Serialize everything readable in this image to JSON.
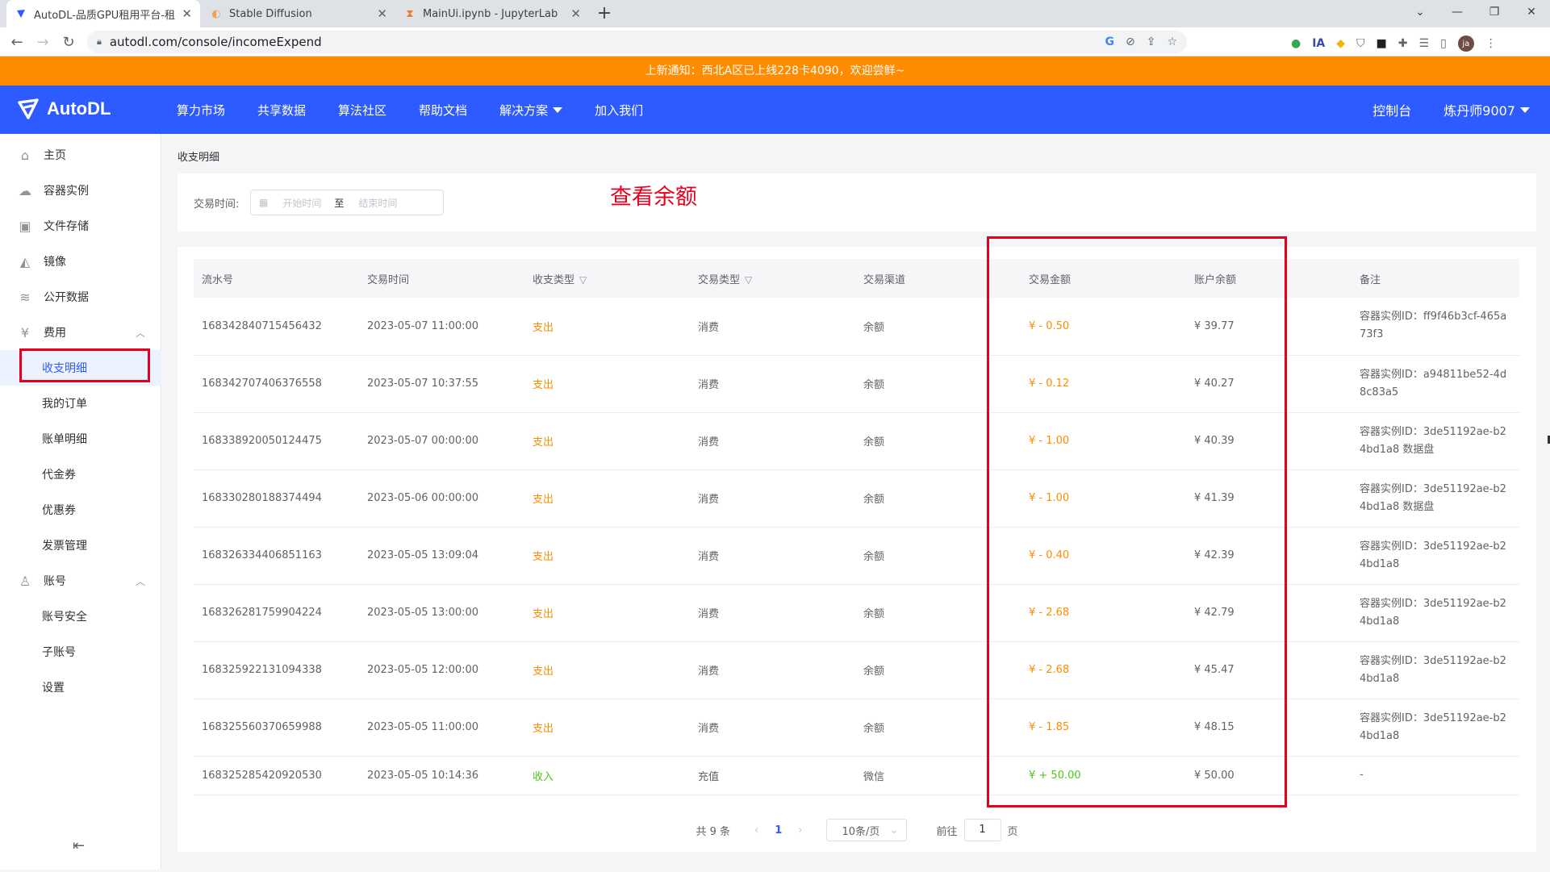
{
  "browser": {
    "tabs": [
      {
        "title": "AutoDL-品质GPU租用平台-租G",
        "active": true
      },
      {
        "title": "Stable Diffusion",
        "active": false
      },
      {
        "title": "MainUi.ipynb - JupyterLab",
        "active": false
      }
    ],
    "url": "autodl.com/console/incomeExpend",
    "profile_initials": "ja"
  },
  "notice": "上新通知：西北A区已上线228卡4090，欢迎尝鲜~",
  "header": {
    "logo": "AutoDL",
    "nav": [
      "算力市场",
      "共享数据",
      "算法社区",
      "帮助文档",
      "解决方案",
      "加入我们"
    ],
    "console": "控制台",
    "user": "炼丹师9007"
  },
  "sidebar": {
    "items": [
      {
        "label": "主页",
        "icon": "home-icon",
        "icon_char": "⌂"
      },
      {
        "label": "容器实例",
        "icon": "container-icon",
        "icon_char": "☁"
      },
      {
        "label": "文件存储",
        "icon": "storage-icon",
        "icon_char": "▣"
      },
      {
        "label": "镜像",
        "icon": "mirror-icon",
        "icon_char": "◭"
      },
      {
        "label": "公开数据",
        "icon": "database-icon",
        "icon_char": "≋"
      },
      {
        "label": "费用",
        "icon": "yen-icon",
        "icon_char": "¥"
      }
    ],
    "fee_sub": [
      "收支明细",
      "我的订单",
      "账单明细",
      "代金券",
      "优惠券",
      "发票管理"
    ],
    "account": {
      "label": "账号",
      "icon": "user-icon",
      "icon_char": "♙"
    },
    "account_sub": [
      "账号安全",
      "子账号",
      "设置"
    ]
  },
  "page": {
    "breadcrumb": "收支明细",
    "filter_label": "交易时间:",
    "start_placeholder": "开始时间",
    "range_sep": "至",
    "end_placeholder": "结束时间",
    "annotation": "查看余额"
  },
  "table": {
    "headers": [
      "流水号",
      "交易时间",
      "收支类型",
      "交易类型",
      "交易渠道",
      "交易金额",
      "账户余额",
      "备注"
    ],
    "rows": [
      {
        "id": "168342840715456432",
        "time": "2023-05-07 11:00:00",
        "direction": "支出",
        "type": "消费",
        "channel": "余额",
        "amount": "¥ - 0.50",
        "balance": "¥ 39.77",
        "remark": "容器实例ID：ff9f46b3cf-465a73f3"
      },
      {
        "id": "168342707406376558",
        "time": "2023-05-07 10:37:55",
        "direction": "支出",
        "type": "消费",
        "channel": "余额",
        "amount": "¥ - 0.12",
        "balance": "¥ 40.27",
        "remark": "容器实例ID：a94811be52-4d8c83a5"
      },
      {
        "id": "168338920050124475",
        "time": "2023-05-07 00:00:00",
        "direction": "支出",
        "type": "消费",
        "channel": "余额",
        "amount": "¥ - 1.00",
        "balance": "¥ 40.39",
        "remark": "容器实例ID：3de51192ae-b24bd1a8 数据盘"
      },
      {
        "id": "168330280188374494",
        "time": "2023-05-06 00:00:00",
        "direction": "支出",
        "type": "消费",
        "channel": "余额",
        "amount": "¥ - 1.00",
        "balance": "¥ 41.39",
        "remark": "容器实例ID：3de51192ae-b24bd1a8 数据盘"
      },
      {
        "id": "168326334406851163",
        "time": "2023-05-05 13:09:04",
        "direction": "支出",
        "type": "消费",
        "channel": "余额",
        "amount": "¥ - 0.40",
        "balance": "¥ 42.39",
        "remark": "容器实例ID：3de51192ae-b24bd1a8"
      },
      {
        "id": "168326281759904224",
        "time": "2023-05-05 13:00:00",
        "direction": "支出",
        "type": "消费",
        "channel": "余额",
        "amount": "¥ - 2.68",
        "balance": "¥ 42.79",
        "remark": "容器实例ID：3de51192ae-b24bd1a8"
      },
      {
        "id": "168325922131094338",
        "time": "2023-05-05 12:00:00",
        "direction": "支出",
        "type": "消费",
        "channel": "余额",
        "amount": "¥ - 2.68",
        "balance": "¥ 45.47",
        "remark": "容器实例ID：3de51192ae-b24bd1a8"
      },
      {
        "id": "168325560370659988",
        "time": "2023-05-05 11:00:00",
        "direction": "支出",
        "type": "消费",
        "channel": "余额",
        "amount": "¥ - 1.85",
        "balance": "¥ 48.15",
        "remark": "容器实例ID：3de51192ae-b24bd1a8"
      },
      {
        "id": "168325285420920530",
        "time": "2023-05-05 10:14:36",
        "direction": "收入",
        "type": "充值",
        "channel": "微信",
        "amount": "¥ + 50.00",
        "balance": "¥ 50.00",
        "remark": "-"
      }
    ]
  },
  "pagination": {
    "total": "共 9 条",
    "current_page": "1",
    "page_size": "10条/页",
    "goto_label": "前往",
    "goto_value": "1",
    "page_unit": "页"
  },
  "colors": {
    "brand": "#2e5bff",
    "notice": "#ff8c00",
    "expense": "#ff8c00",
    "income": "#52c41a",
    "highlight": "#e6001e"
  }
}
